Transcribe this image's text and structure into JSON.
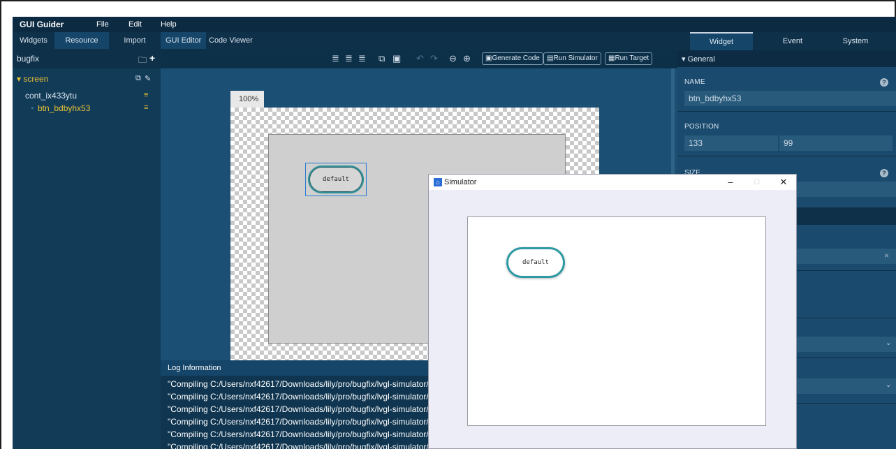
{
  "menubar": {
    "app_title": "GUI Guider",
    "items": [
      "File",
      "Edit",
      "Help"
    ]
  },
  "left_panel": {
    "tabs": [
      {
        "label": "Widgets",
        "active": false
      },
      {
        "label": "Resource",
        "active": true
      },
      {
        "label": "Import",
        "active": false
      }
    ],
    "project_name": "bugfix",
    "tree": [
      {
        "label": "▾ screen",
        "level": 0,
        "selected": true
      },
      {
        "label": "cont_ix433ytu",
        "level": 1,
        "selected": false
      },
      {
        "label": "btn_bdbyhx53",
        "level": 2,
        "selected": true
      }
    ]
  },
  "editor": {
    "tabs": [
      {
        "label": "GUI Editor",
        "active": true
      },
      {
        "label": "Code Viewer",
        "active": false
      }
    ],
    "toolbar_buttons": [
      "Generate Code",
      "Run Simulator",
      "Run Target"
    ],
    "zoom": "100%",
    "widget_text": "default"
  },
  "log": {
    "title": "Log Information",
    "lines": [
      "\"Compiling C:/Users/nxf42617/Downloads/lily/pro/bugfix/lvgl-simulator/r",
      "\"Compiling C:/Users/nxf42617/Downloads/lily/pro/bugfix/lvgl-simulator/..",
      "\"Compiling C:/Users/nxf42617/Downloads/lily/pro/bugfix/lvgl-simulator/..",
      "\"Compiling C:/Users/nxf42617/Downloads/lily/pro/bugfix/lvgl-simulator/..",
      "\"Compiling C:/Users/nxf42617/Downloads/lily/pro/bugfix/lvgl-simulator/..",
      "\"Compiling C:/Users/nxf42617/Downloads/lily/pro/bugfix/lvgl-simulator/.."
    ]
  },
  "right_panel": {
    "tabs": [
      {
        "label": "Widget",
        "active": true
      },
      {
        "label": "Event",
        "active": false
      },
      {
        "label": "System",
        "active": false
      }
    ],
    "general_label": "▾ General",
    "name_label": "NAME",
    "name_value": "btn_bdbyhx53",
    "position_label": "POSITION",
    "position_x": "133",
    "position_y": "99",
    "size_label": "SIZE"
  },
  "simulator": {
    "title": "Simulator",
    "button_text": "default"
  },
  "colors": {
    "app_bg": "#0f3550",
    "panel_bg": "#123b58",
    "canvas_bg": "#1b4f73",
    "tree_selected": "#e8c233",
    "button_border": "#2e8f98"
  }
}
